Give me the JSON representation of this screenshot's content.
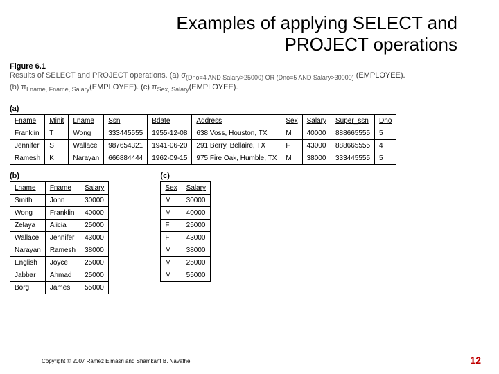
{
  "title_line1": "Examples of applying SELECT and",
  "title_line2": "PROJECT operations",
  "figure_label": "Figure 6.1",
  "figure_desc_prefix": "Results of SELECT and PROJECT operations. (a) ",
  "sigma": "σ",
  "sigma_sub": "(Dno=4 AND Salary>25000) OR (Dno=5 AND Salary>30000)",
  "emp_a": "(EMPLOYEE).",
  "desc_b_prefix": "(b) ",
  "pi": "π",
  "pi_b_sub": "Lname, Fname, Salary",
  "emp_b": "(EMPLOYEE). (c) ",
  "pi_c_sub": "Sex, Salary",
  "emp_c": "(EMPLOYEE).",
  "part_a": "(a)",
  "part_b": "(b)",
  "part_c": "(c)",
  "table_a": {
    "headers": [
      "Fname",
      "Minit",
      "Lname",
      "Ssn",
      "Bdate",
      "Address",
      "Sex",
      "Salary",
      "Super_ssn",
      "Dno"
    ],
    "rows": [
      [
        "Franklin",
        "T",
        "Wong",
        "333445555",
        "1955-12-08",
        "638 Voss, Houston, TX",
        "M",
        "40000",
        "888665555",
        "5"
      ],
      [
        "Jennifer",
        "S",
        "Wallace",
        "987654321",
        "1941-06-20",
        "291 Berry, Bellaire, TX",
        "F",
        "43000",
        "888665555",
        "4"
      ],
      [
        "Ramesh",
        "K",
        "Narayan",
        "666884444",
        "1962-09-15",
        "975 Fire Oak, Humble, TX",
        "M",
        "38000",
        "333445555",
        "5"
      ]
    ]
  },
  "table_b": {
    "headers": [
      "Lname",
      "Fname",
      "Salary"
    ],
    "rows": [
      [
        "Smith",
        "John",
        "30000"
      ],
      [
        "Wong",
        "Franklin",
        "40000"
      ],
      [
        "Zelaya",
        "Alicia",
        "25000"
      ],
      [
        "Wallace",
        "Jennifer",
        "43000"
      ],
      [
        "Narayan",
        "Ramesh",
        "38000"
      ],
      [
        "English",
        "Joyce",
        "25000"
      ],
      [
        "Jabbar",
        "Ahmad",
        "25000"
      ],
      [
        "Borg",
        "James",
        "55000"
      ]
    ]
  },
  "table_c": {
    "headers": [
      "Sex",
      "Salary"
    ],
    "rows": [
      [
        "M",
        "30000"
      ],
      [
        "M",
        "40000"
      ],
      [
        "F",
        "25000"
      ],
      [
        "F",
        "43000"
      ],
      [
        "M",
        "38000"
      ],
      [
        "M",
        "25000"
      ],
      [
        "M",
        "55000"
      ]
    ]
  },
  "footer_left": "Copyright © 2007 Ramez Elmasri and Shamkant B. Navathe",
  "footer_right": "12"
}
